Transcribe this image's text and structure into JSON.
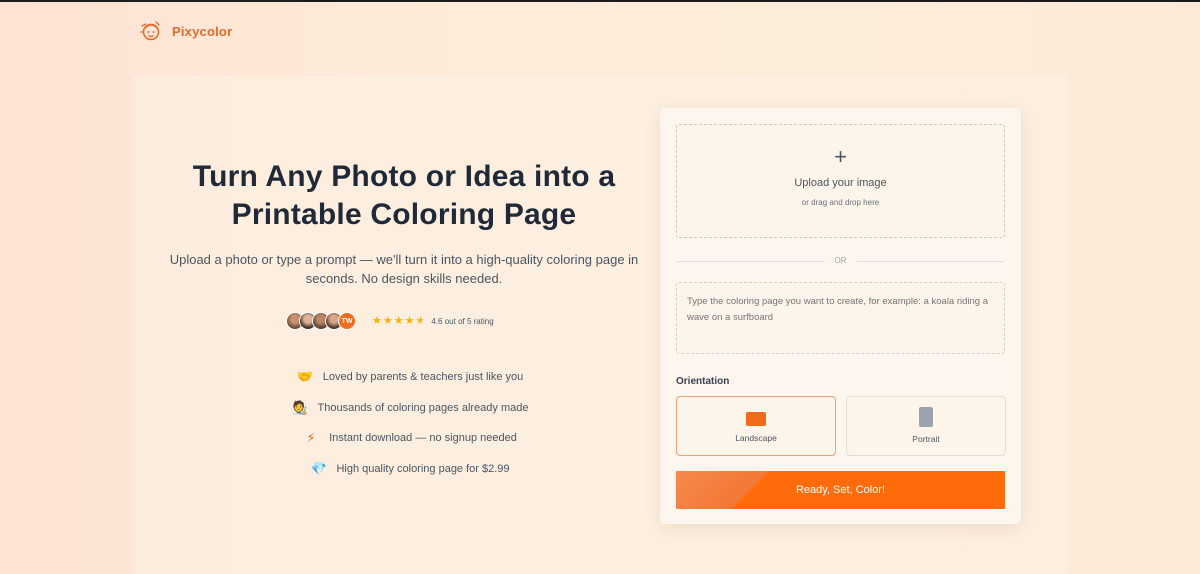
{
  "app": {
    "brand_name": "Pixycolor",
    "brand_color": "#e8692b",
    "logo_icon": "cartoon-face-icon"
  },
  "hero": {
    "title": "Turn Any Photo or Idea into a Printable Coloring Page",
    "subtitle": "Upload a photo or type a prompt — we'll turn it into a high-quality coloring page in seconds. No design skills needed."
  },
  "rating": {
    "avatar_initials": "TW",
    "stars": 4.6,
    "text": "4.6 out of 5 rating",
    "star_color": "#f6b400"
  },
  "features": [
    {
      "icon": "handshake-icon",
      "label": "Loved by parents & teachers just like you"
    },
    {
      "icon": "artist-icon",
      "label": "Thousands of coloring pages already made"
    },
    {
      "icon": "lightning-icon",
      "label": "Instant download — no signup needed"
    },
    {
      "icon": "diamond-icon",
      "label": "High quality coloring page for $2.99"
    }
  ],
  "form": {
    "upload_title": "Upload your image",
    "upload_hint": "or drag and drop here",
    "or_label": "OR",
    "prompt_placeholder": "Type the coloring page you want to create, for example: a koala riding a wave on a surfboard",
    "orientation_label": "Orientation",
    "orientation_options": [
      {
        "label": "Landscape",
        "selected": true
      },
      {
        "label": "Portrait",
        "selected": false
      }
    ],
    "submit_label": "Ready, Set, Color!",
    "accent_color": "#ff6b0a"
  }
}
